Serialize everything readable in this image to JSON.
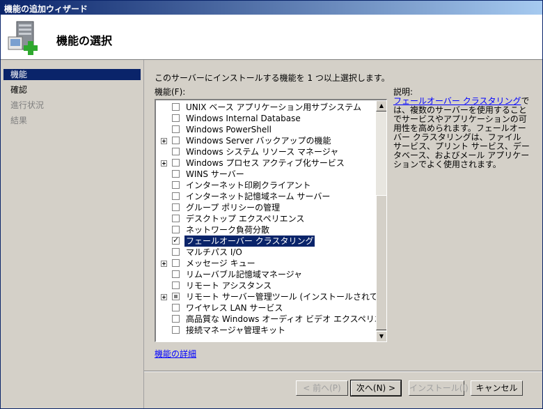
{
  "window": {
    "title": "機能の追加ウィザード"
  },
  "header": {
    "title": "機能の選択",
    "icon": "server-add-icon"
  },
  "nav": {
    "items": [
      {
        "label": "機能",
        "state": "active"
      },
      {
        "label": "確認",
        "state": "normal"
      },
      {
        "label": "進行状況",
        "state": "disabled"
      },
      {
        "label": "結果",
        "state": "disabled"
      }
    ]
  },
  "main": {
    "instruction": "このサーバーにインストールする機能を 1 つ以上選択します。",
    "features_label": "機能(F):",
    "features": [
      {
        "label": "UNIX ベース アプリケーション用サブシステム",
        "expander": false,
        "state": "unchecked"
      },
      {
        "label": "Windows Internal Database",
        "expander": false,
        "state": "unchecked"
      },
      {
        "label": "Windows PowerShell",
        "expander": false,
        "state": "unchecked"
      },
      {
        "label": "Windows Server バックアップの機能",
        "expander": true,
        "state": "unchecked"
      },
      {
        "label": "Windows システム リソース マネージャ",
        "expander": false,
        "state": "unchecked"
      },
      {
        "label": "Windows プロセス アクティブ化サービス",
        "expander": true,
        "state": "unchecked"
      },
      {
        "label": "WINS サーバー",
        "expander": false,
        "state": "unchecked"
      },
      {
        "label": "インターネット印刷クライアント",
        "expander": false,
        "state": "unchecked"
      },
      {
        "label": "インターネット記憶域ネーム サーバー",
        "expander": false,
        "state": "unchecked"
      },
      {
        "label": "グループ ポリシーの管理",
        "expander": false,
        "state": "unchecked"
      },
      {
        "label": "デスクトップ エクスペリエンス",
        "expander": false,
        "state": "unchecked"
      },
      {
        "label": "ネットワーク負荷分散",
        "expander": false,
        "state": "unchecked"
      },
      {
        "label": "フェールオーバー クラスタリング",
        "expander": false,
        "state": "checked",
        "selected": true
      },
      {
        "label": "マルチパス I/O",
        "expander": false,
        "state": "unchecked"
      },
      {
        "label": "メッセージ キュー",
        "expander": true,
        "state": "unchecked"
      },
      {
        "label": "リムーバブル記憶域マネージャ",
        "expander": false,
        "state": "unchecked"
      },
      {
        "label": "リモート アシスタンス",
        "expander": false,
        "state": "unchecked"
      },
      {
        "label": "リモート サーバー管理ツール (インストールされています)",
        "expander": true,
        "state": "partial"
      },
      {
        "label": "ワイヤレス LAN サービス",
        "expander": false,
        "state": "unchecked"
      },
      {
        "label": "高品質な Windows オーディオ ビデオ エクスペリエンス",
        "expander": false,
        "state": "unchecked"
      },
      {
        "label": "接続マネージャ管理キット",
        "expander": false,
        "state": "unchecked"
      }
    ],
    "details_link": "機能の詳細"
  },
  "description": {
    "label": "説明:",
    "link_text": "フェールオーバー クラスタリング",
    "text": "では、複数のサーバーを使用することでサービスやアプリケーションの可用性を高められます。フェールオーバー クラスタリングは、ファイル サービス、プリント サービス、データベース、およびメール アプリケーションでよく使用されます。"
  },
  "buttons": {
    "back": "< 前へ(P)",
    "next": "次へ(N) >",
    "install": "インストール(I)",
    "cancel": "キャンセル"
  },
  "colors": {
    "selection": "#0a246a",
    "link": "#0000ff",
    "dialog_bg": "#d4d0c8"
  }
}
